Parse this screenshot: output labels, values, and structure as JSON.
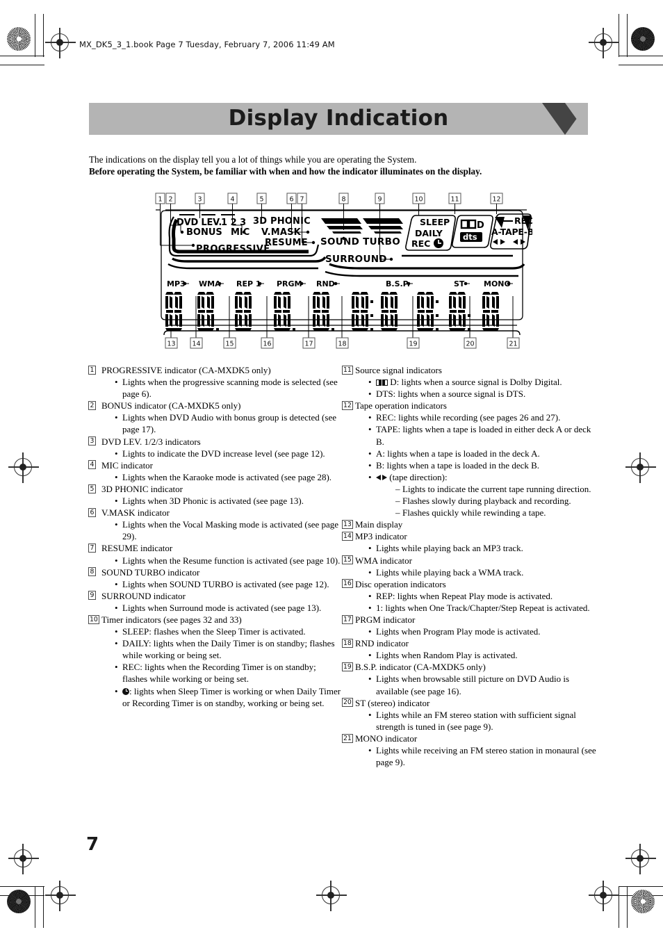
{
  "header": {
    "file_line": "MX_DK5_3_1.book  Page 7  Tuesday, February 7, 2006  11:49 AM"
  },
  "title": {
    "text": "Display Indication"
  },
  "intro": {
    "line1": "The indications on the display tell you a lot of things while you are operating the System.",
    "line2": "Before operating the System, be familiar with when and how the indicator illuminates on the display."
  },
  "figure": {
    "caption": "Front panel display illustration with numbered callouts",
    "top_callouts": [
      "1",
      "2",
      "3",
      "4",
      "5",
      "6",
      "7",
      "8",
      "9",
      "10",
      "11",
      "12"
    ],
    "bottom_callouts": [
      "13",
      "14",
      "15",
      "16",
      "17",
      "18",
      "19",
      "20",
      "21"
    ],
    "labels": {
      "dvd_lev": "DVD LEV.",
      "dvd_lev_digits": "1 2 3",
      "bonus": "BONUS",
      "mic": "MIC",
      "progressive": "PROGRESSIVE",
      "phonic_3d": "3D PHONIC",
      "vmask": "V.MASK",
      "resume": "RESUME",
      "sound_turbo": "SOUND TURBO",
      "surround": "SURROUND",
      "sleep": "SLEEP",
      "daily": "DAILY",
      "rec_timer": "REC",
      "dolby": "D",
      "dts": "dts",
      "rec_tape": "REC",
      "a_tape_b": "A-TAPE-B",
      "mp3": "MP3",
      "wma": "WMA",
      "rep1": "REP 1",
      "prgm": "PRGM",
      "rnd": "RND",
      "bsp": "B.S.P.",
      "st": "ST",
      "mono": "MONO"
    }
  },
  "left_column": [
    {
      "num": "1",
      "title": "PROGRESSIVE indicator (CA-MXDK5 only)",
      "bullets": [
        "Lights when the progressive scanning mode is selected (see page 6)."
      ]
    },
    {
      "num": "2",
      "title": "BONUS indicator (CA-MXDK5 only)",
      "bullets": [
        "Lights when DVD Audio with bonus group is detected (see page 17)."
      ]
    },
    {
      "num": "3",
      "title": "DVD LEV. 1/2/3 indicators",
      "bullets": [
        "Lights to indicate the DVD increase level (see page 12)."
      ]
    },
    {
      "num": "4",
      "title": "MIC indicator",
      "bullets": [
        "Lights when the Karaoke mode is activated (see page 28)."
      ]
    },
    {
      "num": "5",
      "title": "3D PHONIC indicator",
      "bullets": [
        "Lights when 3D Phonic is activated (see page 13)."
      ]
    },
    {
      "num": "6",
      "title": "V.MASK indicator",
      "bullets": [
        "Lights when the Vocal Masking mode is activated (see page 29)."
      ]
    },
    {
      "num": "7",
      "title": "RESUME indicator",
      "bullets": [
        "Lights when the Resume function is activated (see page 10)."
      ]
    },
    {
      "num": "8",
      "title": "SOUND TURBO indicator",
      "bullets": [
        "Lights when SOUND TURBO is activated (see page 12)."
      ]
    },
    {
      "num": "9",
      "title": "SURROUND indicator",
      "bullets": [
        "Lights when Surround mode is activated (see page 13)."
      ]
    },
    {
      "num": "10",
      "title": "Timer indicators (see pages 32 and 33)",
      "bullets": [
        "SLEEP: flashes when the Sleep Timer is activated.",
        "DAILY: lights when the Daily Timer is on standby; flashes while working or being set.",
        "REC: lights when the Recording Timer is on standby; flashes while working or being set."
      ],
      "clock_bullet": ": lights when Sleep Timer is working or when Daily Timer or Recording Timer is on standby, working or being set."
    }
  ],
  "right_column": [
    {
      "num": "11",
      "title": "Source signal indicators",
      "dolby_bullet": "D: lights when a source signal is Dolby Digital.",
      "bullets": [
        "DTS: lights when a source signal is DTS."
      ]
    },
    {
      "num": "12",
      "title": "Tape operation indicators",
      "bullets": [
        "REC: lights while recording (see pages 26 and 27).",
        "TAPE: lights when a tape is loaded in either deck A or deck B.",
        "A: lights when a tape is loaded in the deck A.",
        "B: lights when a tape is loaded in the deck B."
      ],
      "direction_bullet": "(tape direction):",
      "sub_bullets": [
        "Lights to indicate the current tape running direction.",
        "Flashes slowly during playback and recording.",
        "Flashes quickly while rewinding a tape."
      ]
    },
    {
      "num": "13",
      "title": "Main display",
      "bullets": []
    },
    {
      "num": "14",
      "title": "MP3 indicator",
      "bullets": [
        "Lights while playing back an MP3 track."
      ]
    },
    {
      "num": "15",
      "title": "WMA indicator",
      "bullets": [
        "Lights while playing back a WMA track."
      ]
    },
    {
      "num": "16",
      "title": "Disc operation indicators",
      "bullets": [
        "REP: lights when Repeat Play mode is activated.",
        "1: lights when One Track/Chapter/Step Repeat is activated."
      ]
    },
    {
      "num": "17",
      "title": "PRGM indicator",
      "bullets": [
        "Lights when Program Play mode is activated."
      ]
    },
    {
      "num": "18",
      "title": "RND indicator",
      "bullets": [
        "Lights when Random Play is activated."
      ]
    },
    {
      "num": "19",
      "title": "B.S.P. indicator (CA-MXDK5 only)",
      "bullets": [
        "Lights when browsable still picture on DVD Audio is available (see page 16)."
      ]
    },
    {
      "num": "20",
      "title": "ST (stereo) indicator",
      "bullets": [
        "Lights while an FM stereo station with sufficient signal strength is tuned in (see page 9)."
      ]
    },
    {
      "num": "21",
      "title": "MONO indicator",
      "bullets": [
        "Lights while receiving an FM stereo station in monaural (see page 9)."
      ]
    }
  ],
  "footer": {
    "page_number": "7"
  },
  "colors": {
    "banner_bg": "#b4b4b4",
    "banner_arrow": "#444444",
    "text": "#000000"
  }
}
